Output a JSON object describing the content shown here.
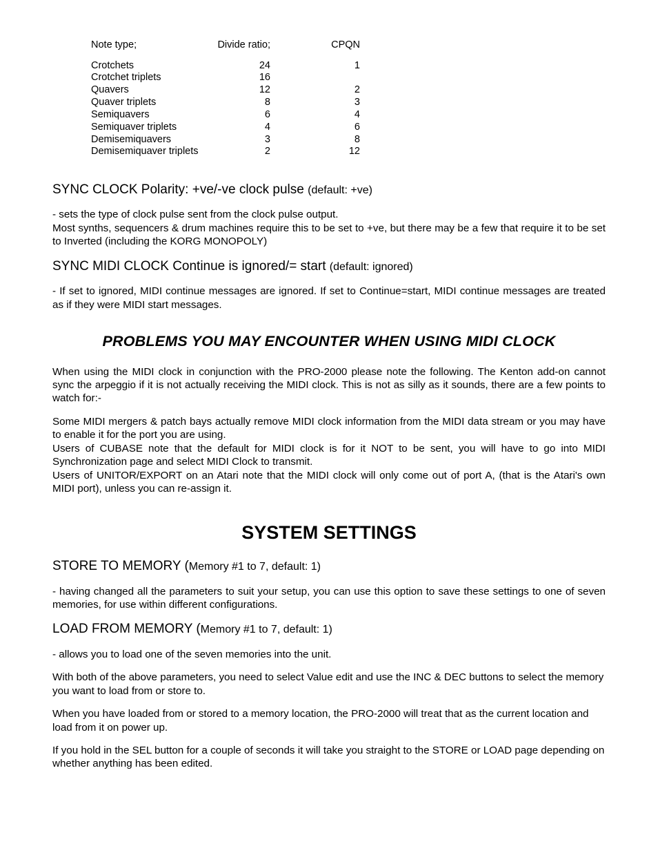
{
  "table": {
    "headers": {
      "note": "Note type;",
      "div": "Divide ratio;",
      "cpqn": "CPQN"
    },
    "rows": [
      {
        "note": "Crotchets",
        "div": "24",
        "cpqn": "1"
      },
      {
        "note": "Crotchet triplets",
        "div": "16",
        "cpqn": ""
      },
      {
        "note": "Quavers",
        "div": "12",
        "cpqn": "2"
      },
      {
        "note": "Quaver triplets",
        "div": "8",
        "cpqn": "3"
      },
      {
        "note": "Semiquavers",
        "div": "6",
        "cpqn": "4"
      },
      {
        "note": "Semiquaver triplets",
        "div": "4",
        "cpqn": "6"
      },
      {
        "note": "Demisemiquavers",
        "div": "3",
        "cpqn": "8"
      },
      {
        "note": "Demisemiquaver triplets",
        "div": "2",
        "cpqn": "12"
      }
    ]
  },
  "sync_clock": {
    "title_main": "SYNC  CLOCK Polarity: +ve/-ve clock pulse ",
    "title_small": "(default: +ve)",
    "p1": "- sets the type of clock pulse sent from the clock pulse output.",
    "p2": "Most synths, sequencers & drum machines require this to be set to +ve, but there may be a few that require it to be set to Inverted (including the KORG MONOPOLY)"
  },
  "sync_midi": {
    "title_main": "SYNC  MIDI CLOCK Continue is ignored/= start ",
    "title_small": "(default: ignored)",
    "p1": "- If set to ignored, MIDI continue messages are ignored. If set to Continue=start, MIDI continue messages are treated as if they were MIDI start messages."
  },
  "problems": {
    "title": "PROBLEMS YOU MAY ENCOUNTER WHEN USING MIDI CLOCK",
    "p1": "When using the MIDI clock in conjunction with the PRO-2000 please note the following. The Kenton add-on cannot sync the arpeggio if it is not actually receiving the MIDI clock. This is not as silly as it sounds, there are a few points to watch for:-",
    "p2": "Some MIDI mergers & patch bays actually remove MIDI clock information from the MIDI data stream or you may have to enable it for the port you are using.",
    "p3": "Users of CUBASE note that the default for MIDI clock is for it NOT to be sent, you will have to go into MIDI Synchronization page and select MIDI Clock to transmit.",
    "p4": "Users of UNITOR/EXPORT on an Atari note that the MIDI clock will only come out of port A, (that is the Atari's own MIDI port), unless you can re-assign it."
  },
  "system": {
    "title": "SYSTEM SETTINGS",
    "store": {
      "title_main": "STORE TO MEMORY (",
      "title_small": "Memory #1 to 7, default: 1)",
      "p1": "- having changed all the parameters to suit your setup, you can use this option to save these settings to one of seven memories, for use within different configurations."
    },
    "load": {
      "title_main": "LOAD FROM MEMORY (",
      "title_small": "Memory #1 to 7, default: 1)",
      "p1": "- allows you to load one of the seven memories into the unit.",
      "p2": "With both of the above parameters, you need to select Value edit and use the INC & DEC buttons to select the memory you want to load from or store to.",
      "p3": "When you have loaded from or stored to a memory location, the PRO-2000 will treat that as the current location and load from it on power up.",
      "p4": "If you hold in the SEL button for a couple of seconds it will take you straight to the STORE or LOAD page depending on whether anything has been edited."
    }
  }
}
